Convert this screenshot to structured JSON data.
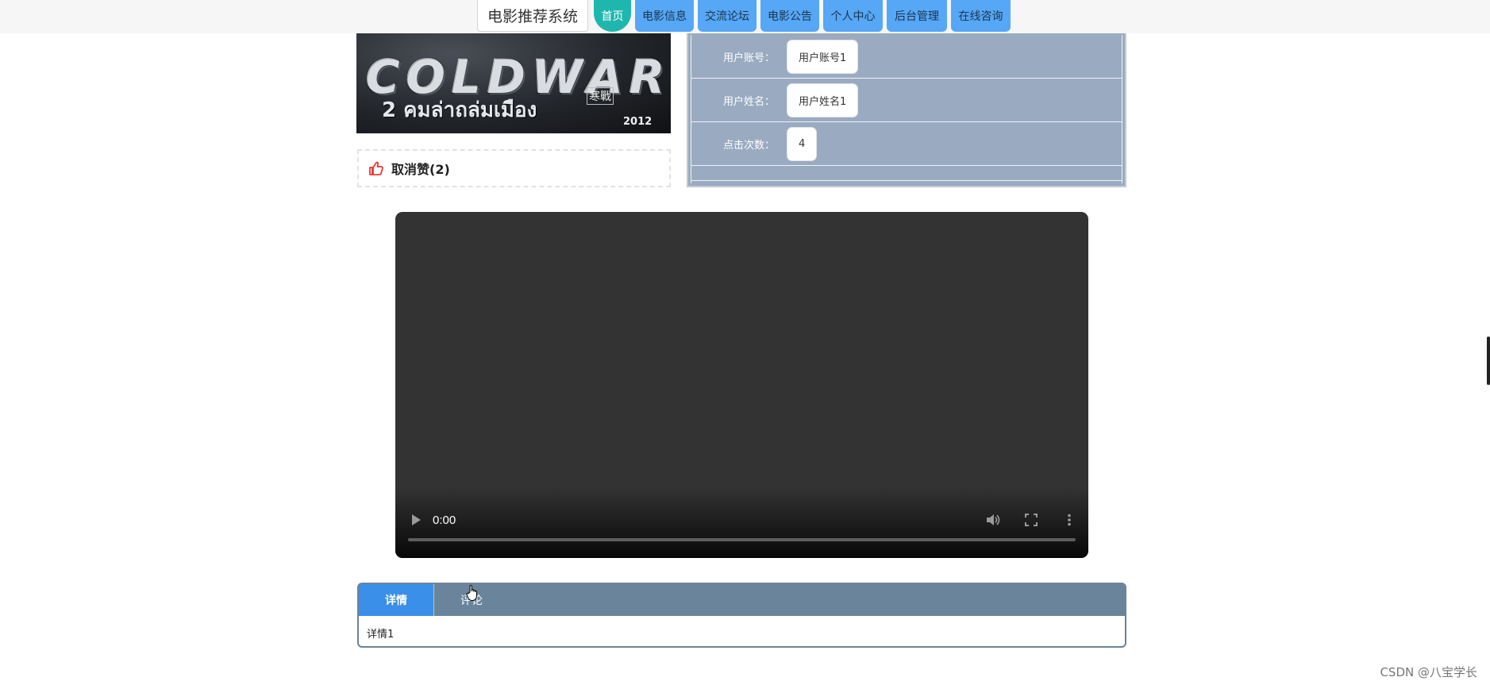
{
  "app": {
    "title": "电影推荐系统"
  },
  "nav": {
    "items": [
      {
        "label": "首页",
        "active": true
      },
      {
        "label": "电影信息"
      },
      {
        "label": "交流论坛"
      },
      {
        "label": "电影公告"
      },
      {
        "label": "个人中心"
      },
      {
        "label": "后台管理"
      },
      {
        "label": "在线咨询"
      }
    ]
  },
  "poster": {
    "title": "COLDWAR",
    "subtitle": "2 คมล่าถล่มเมือง",
    "tag": "寒戰",
    "year": "2012"
  },
  "like": {
    "label": "取消赞(2)",
    "icon": "thumbs-up-icon"
  },
  "info": {
    "rows": [
      {
        "label": "用户账号：",
        "value": "用户账号1"
      },
      {
        "label": "用户姓名：",
        "value": "用户姓名1"
      },
      {
        "label": "点击次数：",
        "value": "4"
      }
    ]
  },
  "video": {
    "time": "0:00",
    "progress": 0
  },
  "tabs": {
    "items": [
      {
        "label": "详情",
        "active": true
      },
      {
        "label": "评论"
      }
    ],
    "content": "详情1"
  },
  "watermark": "CSDN @八宝学长",
  "colors": {
    "nav_button": "#56a7f5",
    "nav_active": "#1fb7ad",
    "info_panel": "#9aabc1",
    "tab_bar": "#6a849c",
    "tab_active": "#3a8fe8",
    "like_icon": "#e53935"
  }
}
